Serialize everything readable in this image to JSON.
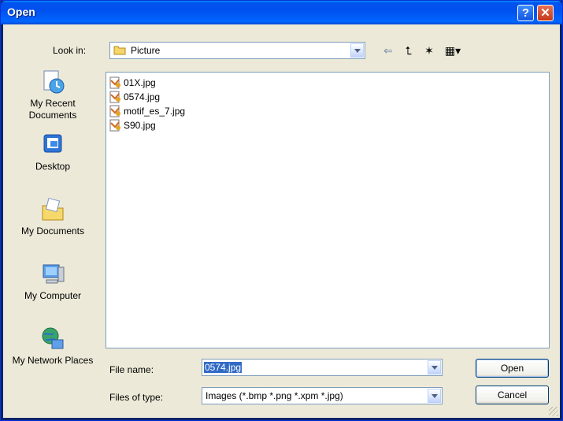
{
  "window": {
    "title": "Open"
  },
  "titlebar_buttons": {
    "help": "?",
    "close": "✕"
  },
  "lookin": {
    "label": "Look in:",
    "value": "Picture"
  },
  "toolbar": {
    "back": "⇐",
    "up": "⮤",
    "new_folder": "✶",
    "view": "▦▾"
  },
  "places": [
    {
      "label": "My Recent Documents"
    },
    {
      "label": "Desktop"
    },
    {
      "label": "My Documents"
    },
    {
      "label": "My Computer"
    },
    {
      "label": "My Network Places"
    }
  ],
  "files": [
    {
      "name": "01X.jpg"
    },
    {
      "name": "0574.jpg"
    },
    {
      "name": "motif_es_7.jpg"
    },
    {
      "name": "S90.jpg"
    }
  ],
  "file_name": {
    "label": "File name:",
    "value": "0574.jpg"
  },
  "file_type": {
    "label": "Files of type:",
    "value": "Images (*.bmp *.png *.xpm *.jpg)"
  },
  "buttons": {
    "open": "Open",
    "cancel": "Cancel"
  },
  "colors": {
    "titlebar": "#0054e3",
    "selection": "#316ac5",
    "face": "#ece9d8"
  }
}
